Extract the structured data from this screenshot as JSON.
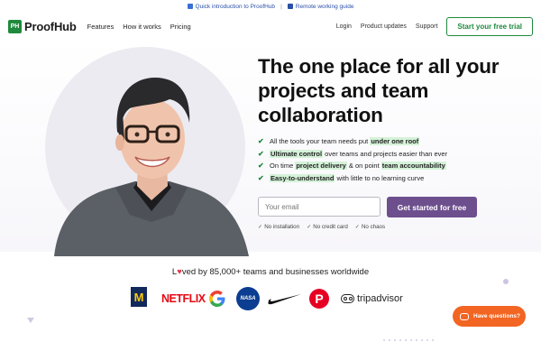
{
  "topbar": {
    "link1": "Quick introduction to ProofHub",
    "separator": "|",
    "link2": "Remote working guide"
  },
  "nav": {
    "logo_badge": "PH",
    "logo_text": "ProofHub",
    "items": [
      "Features",
      "How it works",
      "Pricing"
    ],
    "right": [
      "Login",
      "Product updates",
      "Support"
    ],
    "trial_button": "Start your free trial"
  },
  "hero": {
    "headline": "The one place for all your projects and team collaboration",
    "features": [
      {
        "pre": "All the tools your team needs put ",
        "hl": "under one roof",
        "post": "",
        "hl2": "",
        "post2": ""
      },
      {
        "pre": "",
        "hl": "Ultimate control",
        "post": " over teams and projects easier than ever",
        "hl2": "",
        "post2": ""
      },
      {
        "pre": "On time ",
        "hl": "project delivery",
        "post": " & on point ",
        "hl2": "team accountability",
        "post2": ""
      },
      {
        "pre": "",
        "hl": "Easy-to-understand",
        "post": " with little to no learning curve",
        "hl2": "",
        "post2": ""
      }
    ],
    "email_placeholder": "Your email",
    "cta_button": "Get started for free",
    "notes": [
      "No installation",
      "No credit card",
      "No chaos"
    ]
  },
  "social_proof": {
    "loved_prefix": "L",
    "loved_suffix": "ved by 85,000+ teams and businesses worldwide",
    "logos": {
      "umich": "M",
      "netflix": "NETFLIX",
      "google": "G",
      "nasa": "NASA",
      "pinterest": "P",
      "tripadvisor": "tripadvisor"
    }
  },
  "chat": {
    "label": "Have questions?"
  },
  "colors": {
    "brand_green": "#1f8a3d",
    "cta_purple": "#6d4f8e",
    "chat_orange": "#f26522",
    "highlight": "#d4f2d8"
  }
}
